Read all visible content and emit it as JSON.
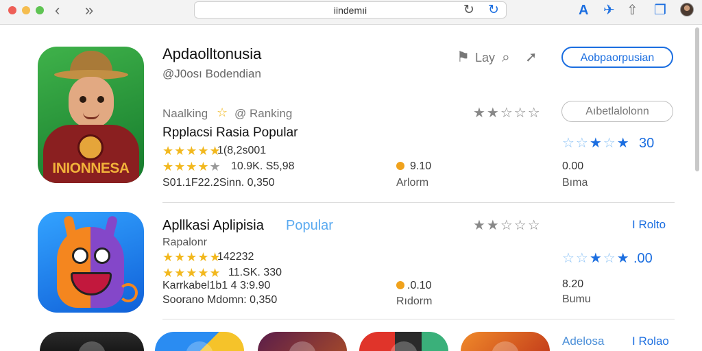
{
  "browser": {
    "address": "iindemıi",
    "nav_back": "‹",
    "nav_forward": "»",
    "reload": "↻",
    "toolbar_icons": [
      "A",
      "✈",
      "⇧",
      "❐"
    ]
  },
  "featured": {
    "title": "Apdaolltonusia",
    "developer": "@J0osı Bodendian",
    "share_label": "Lay",
    "get_button": "Aobpaorpusian",
    "ranking_label": "Naalking",
    "ranking_star": "☆",
    "ranking_at": "@ Ranking",
    "secondary_button": "Aıbetlalolonn",
    "section_title": "Rpplacsi Rasia Popular",
    "stars_count": "1(8,2s001",
    "reviews_count": "10.9K. S5,98",
    "details": "S01.1F22.2Sinn. 0,350",
    "price_value": "9.10",
    "price_label": "Arlorm",
    "blue_rating": "30",
    "side_value": "0.00",
    "side_label": "Bıma",
    "icon_caption": "INIONNESA"
  },
  "popular": {
    "title": "Apllkasi Aplipisia",
    "title_highlight": "Popular",
    "subtitle": "Rapalonr",
    "stars_count": "142232",
    "reviews_count": "11.SK. 330",
    "line_1": "Karrkabel1b1 4 3:9.90",
    "line_2": "Soorano Mdomn: 0,350",
    "price_value": ".0.10",
    "price_label": "Rıdorm",
    "link_label": "I Rolto",
    "blue_rating": ".00",
    "side_value": "8.20",
    "side_label": "Bumu"
  },
  "next_row": {
    "title": "Adelosa",
    "link_label": "I Rolao"
  },
  "colors": {
    "accent": "#1b6ee0",
    "star": "#f2b81e",
    "price_dot": "#f0a21c"
  }
}
